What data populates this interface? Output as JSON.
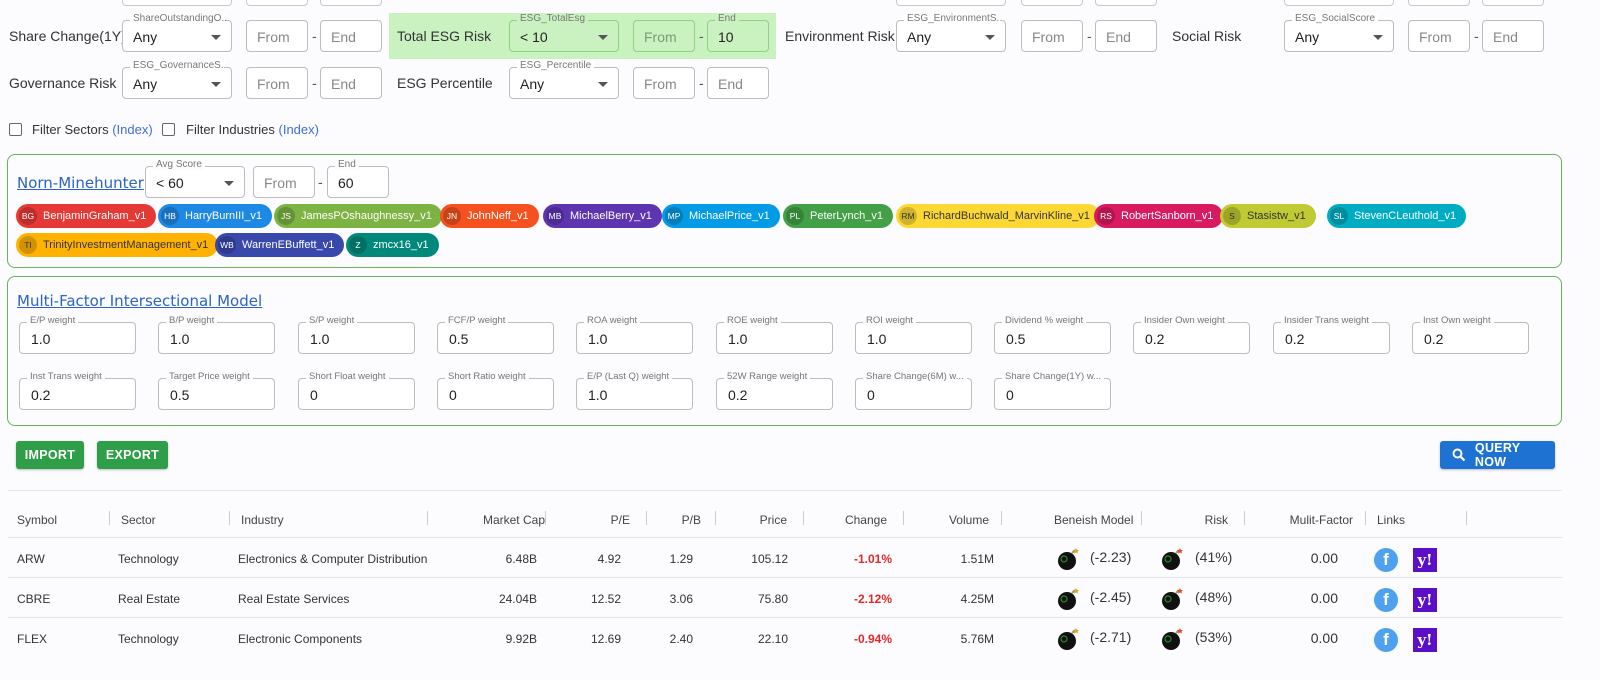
{
  "filters": {
    "share_change_1y": {
      "label": "Share Change(1Y)",
      "select_caption": "ShareOutstandingO...",
      "select_value": "Any",
      "from": "From",
      "end": "End"
    },
    "total_esg_risk": {
      "label": "Total ESG Risk",
      "select_caption": "ESG_TotalEsg",
      "select_value": "< 10",
      "from": "From",
      "end_caption": "End",
      "end_value": "10"
    },
    "environment_risk": {
      "label": "Environment Risk",
      "select_caption": "ESG_EnvironmentS...",
      "select_value": "Any",
      "from": "From",
      "end": "End"
    },
    "social_risk": {
      "label": "Social Risk",
      "select_caption": "ESG_SocialScore",
      "select_value": "Any",
      "from": "From",
      "end": "End"
    },
    "governance_risk": {
      "label": "Governance Risk",
      "select_caption": "ESG_GovernanceS...",
      "select_value": "Any",
      "from": "From",
      "end": "End"
    },
    "esg_percentile": {
      "label": "ESG Percentile",
      "select_caption": "ESG_Percentile",
      "select_value": "Any",
      "from": "From",
      "end": "End"
    },
    "dash": "-"
  },
  "sector_filter": {
    "label": "Filter Sectors",
    "index": "(Index)"
  },
  "industry_filter": {
    "label": "Filter Industries",
    "index": "(Index)"
  },
  "norn": {
    "title": "Norn-Minehunter",
    "avg_caption": "Avg Score",
    "avg_value": "< 60",
    "from": "From",
    "end_caption": "End",
    "end_value": "60",
    "chips": [
      {
        "initials": "BG",
        "name": "BenjaminGraham_v1",
        "color": "#e53935"
      },
      {
        "initials": "HB",
        "name": "HarryBurnIII_v1",
        "color": "#1e88e5"
      },
      {
        "initials": "JS",
        "name": "JamesPOshaughnessy_v1",
        "color": "#7cb342"
      },
      {
        "initials": "JN",
        "name": "JohnNeff_v1",
        "color": "#f4511e"
      },
      {
        "initials": "MB",
        "name": "MichaelBerry_v1",
        "color": "#5e35b1"
      },
      {
        "initials": "MP",
        "name": "MichaelPrice_v1",
        "color": "#039be5"
      },
      {
        "initials": "PL",
        "name": "PeterLynch_v1",
        "color": "#43a047"
      },
      {
        "initials": "RM",
        "name": "RichardBuchwald_MarvinKline_v1",
        "color": "#fdd835"
      },
      {
        "initials": "RS",
        "name": "RobertSanborn_v1",
        "color": "#d81b60"
      },
      {
        "initials": "S",
        "name": "Stasistw_v1",
        "color": "#c0ca33"
      },
      {
        "initials": "SL",
        "name": "StevenCLeuthold_v1",
        "color": "#00acc1"
      },
      {
        "initials": "TI",
        "name": "TrinityInvestmentManagement_v1",
        "color": "#ffb300"
      },
      {
        "initials": "WB",
        "name": "WarrenEBuffett_v1",
        "color": "#3949ab"
      },
      {
        "initials": "Z",
        "name": "zmcx16_v1",
        "color": "#00897b"
      }
    ]
  },
  "mfim": {
    "title": "Multi-Factor Intersectional Model",
    "weights_row1": [
      {
        "label": "E/P weight",
        "value": "1.0"
      },
      {
        "label": "B/P weight",
        "value": "1.0"
      },
      {
        "label": "S/P weight",
        "value": "1.0"
      },
      {
        "label": "FCF/P weight",
        "value": "0.5"
      },
      {
        "label": "ROA weight",
        "value": "1.0"
      },
      {
        "label": "ROE weight",
        "value": "1.0"
      },
      {
        "label": "ROI weight",
        "value": "1.0"
      },
      {
        "label": "Dividend % weight",
        "value": "0.5"
      },
      {
        "label": "Insider Own weight",
        "value": "0.2"
      },
      {
        "label": "Insider Trans weight",
        "value": "0.2"
      },
      {
        "label": "Inst Own weight",
        "value": "0.2"
      }
    ],
    "weights_row2": [
      {
        "label": "Inst Trans weight",
        "value": "0.2"
      },
      {
        "label": "Target Price weight",
        "value": "0.5"
      },
      {
        "label": "Short Float weight",
        "value": "0"
      },
      {
        "label": "Short Ratio weight",
        "value": "0"
      },
      {
        "label": "E/P (Last Q) weight",
        "value": "1.0"
      },
      {
        "label": "52W Range weight",
        "value": "0.2"
      },
      {
        "label": "Share Change(6M) w...",
        "value": "0"
      },
      {
        "label": "Share Change(1Y) w...",
        "value": "0"
      }
    ]
  },
  "buttons": {
    "import": "IMPORT",
    "export": "EXPORT",
    "query": "QUERY NOW"
  },
  "table": {
    "headers": [
      "Symbol",
      "Sector",
      "Industry",
      "Market Cap",
      "P/E",
      "P/B",
      "Price",
      "Change",
      "Volume",
      "Beneish Model",
      "Risk",
      "Mulit-Factor",
      "Links"
    ],
    "rows": [
      {
        "symbol": "ARW",
        "sector": "Technology",
        "industry": "Electronics & Computer Distribution",
        "market_cap": "6.48B",
        "pe": "4.92",
        "pb": "1.29",
        "price": "105.12",
        "change": "-1.01%",
        "volume": "1.51M",
        "beneish": "(-2.23)",
        "risk": "(41%)",
        "multi_factor": "0.00"
      },
      {
        "symbol": "CBRE",
        "sector": "Real Estate",
        "industry": "Real Estate Services",
        "market_cap": "24.04B",
        "pe": "12.52",
        "pb": "3.06",
        "price": "75.80",
        "change": "-2.12%",
        "volume": "4.25M",
        "beneish": "(-2.45)",
        "risk": "(48%)",
        "multi_factor": "0.00"
      },
      {
        "symbol": "FLEX",
        "sector": "Technology",
        "industry": "Electronic Components",
        "market_cap": "9.92B",
        "pe": "12.69",
        "pb": "2.40",
        "price": "22.10",
        "change": "-0.94%",
        "volume": "5.76M",
        "beneish": "(-2.71)",
        "risk": "(53%)",
        "multi_factor": "0.00"
      }
    ]
  },
  "colors": {
    "panel_border": "#67b35c",
    "green_highlight": "#c9f2c0",
    "button_green": "#2e9e48",
    "button_blue": "#1e73d2",
    "negative": "#e0282b"
  }
}
